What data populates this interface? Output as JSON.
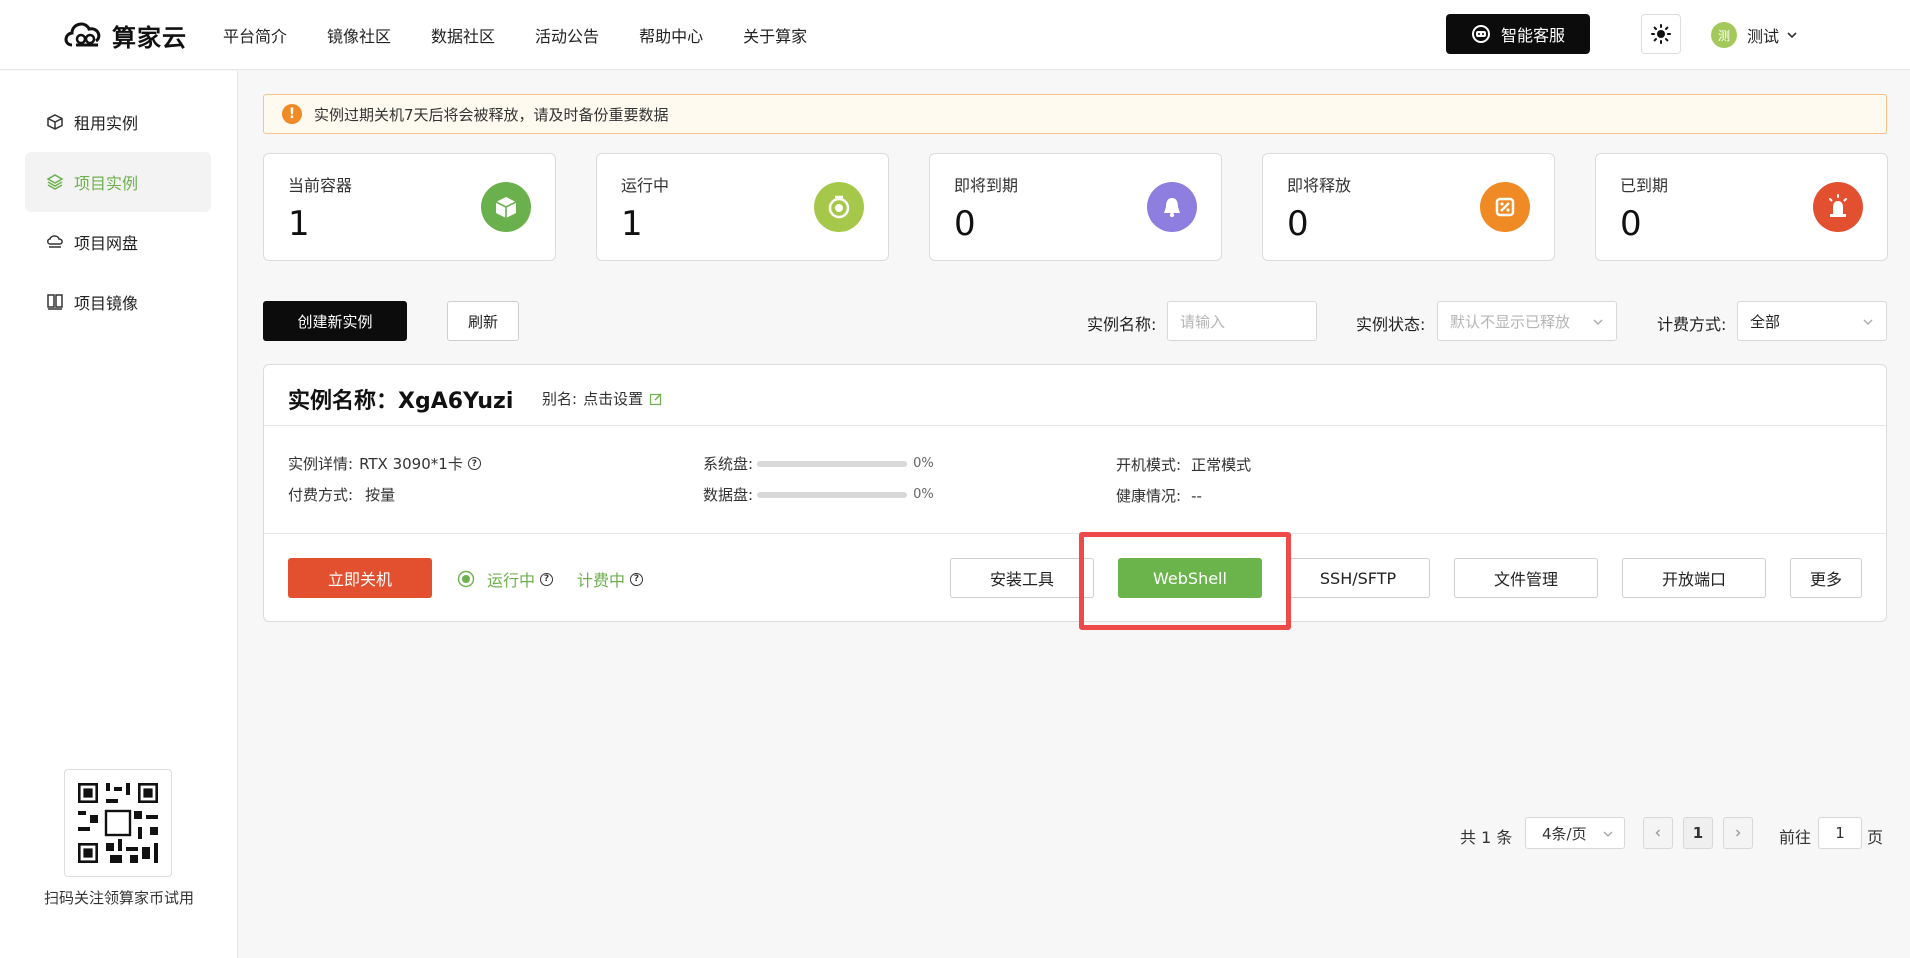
{
  "header": {
    "logo_text": "算家云",
    "nav": [
      "平台简介",
      "镜像社区",
      "数据社区",
      "活动公告",
      "帮助中心",
      "关于算家"
    ],
    "service_label": "智能客服",
    "user_avatar": "测",
    "user_name": "测试"
  },
  "sidebar": {
    "items": [
      {
        "label": "租用实例",
        "icon": "cube-icon"
      },
      {
        "label": "项目实例",
        "icon": "layers-icon"
      },
      {
        "label": "项目网盘",
        "icon": "cloud-drive-icon"
      },
      {
        "label": "项目镜像",
        "icon": "image-icon"
      }
    ],
    "active_index": 1,
    "qr_caption": "扫码关注领算家币试用"
  },
  "notice": "实例过期关机7天后将会被释放，请及时备份重要数据",
  "stats": [
    {
      "label": "当前容器",
      "value": "1",
      "color": "#6ab04c",
      "icon": "container-icon"
    },
    {
      "label": "运行中",
      "value": "1",
      "color": "#a6c84a",
      "icon": "timer-icon"
    },
    {
      "label": "即将到期",
      "value": "0",
      "color": "#8e7ee0",
      "icon": "bell-icon"
    },
    {
      "label": "即将释放",
      "value": "0",
      "color": "#ef8a24",
      "icon": "release-icon"
    },
    {
      "label": "已到期",
      "value": "0",
      "color": "#e25030",
      "icon": "alarm-icon"
    }
  ],
  "toolbar": {
    "create_label": "创建新实例",
    "refresh_label": "刷新",
    "name_label": "实例名称:",
    "name_placeholder": "请输入",
    "status_label": "实例状态:",
    "status_value": "默认不显示已释放",
    "billing_label": "计费方式:",
    "billing_value": "全部"
  },
  "instance": {
    "title": "实例名称：XgA6Yuzi",
    "alias_label": "别名:",
    "alias_link": "点击设置",
    "detail_label": "实例详情:",
    "detail_value": "RTX 3090*1卡",
    "pay_label": "付费方式:",
    "pay_value": "按量",
    "sys_disk_label": "系统盘:",
    "sys_disk_pct": "0%",
    "data_disk_label": "数据盘:",
    "data_disk_pct": "0%",
    "boot_label": "开机模式:",
    "boot_value": "正常模式",
    "health_label": "健康情况:",
    "health_value": "--",
    "shutdown_label": "立即关机",
    "running_label": "运行中",
    "billing_label": "计费中",
    "actions": [
      "安装工具",
      "WebShell",
      "SSH/SFTP",
      "文件管理",
      "开放端口",
      "更多"
    ]
  },
  "pagination": {
    "total": "共 1 条",
    "page_size": "4条/页",
    "current_page": "1",
    "goto_label": "前往",
    "goto_value": "1",
    "page_suffix": "页"
  }
}
